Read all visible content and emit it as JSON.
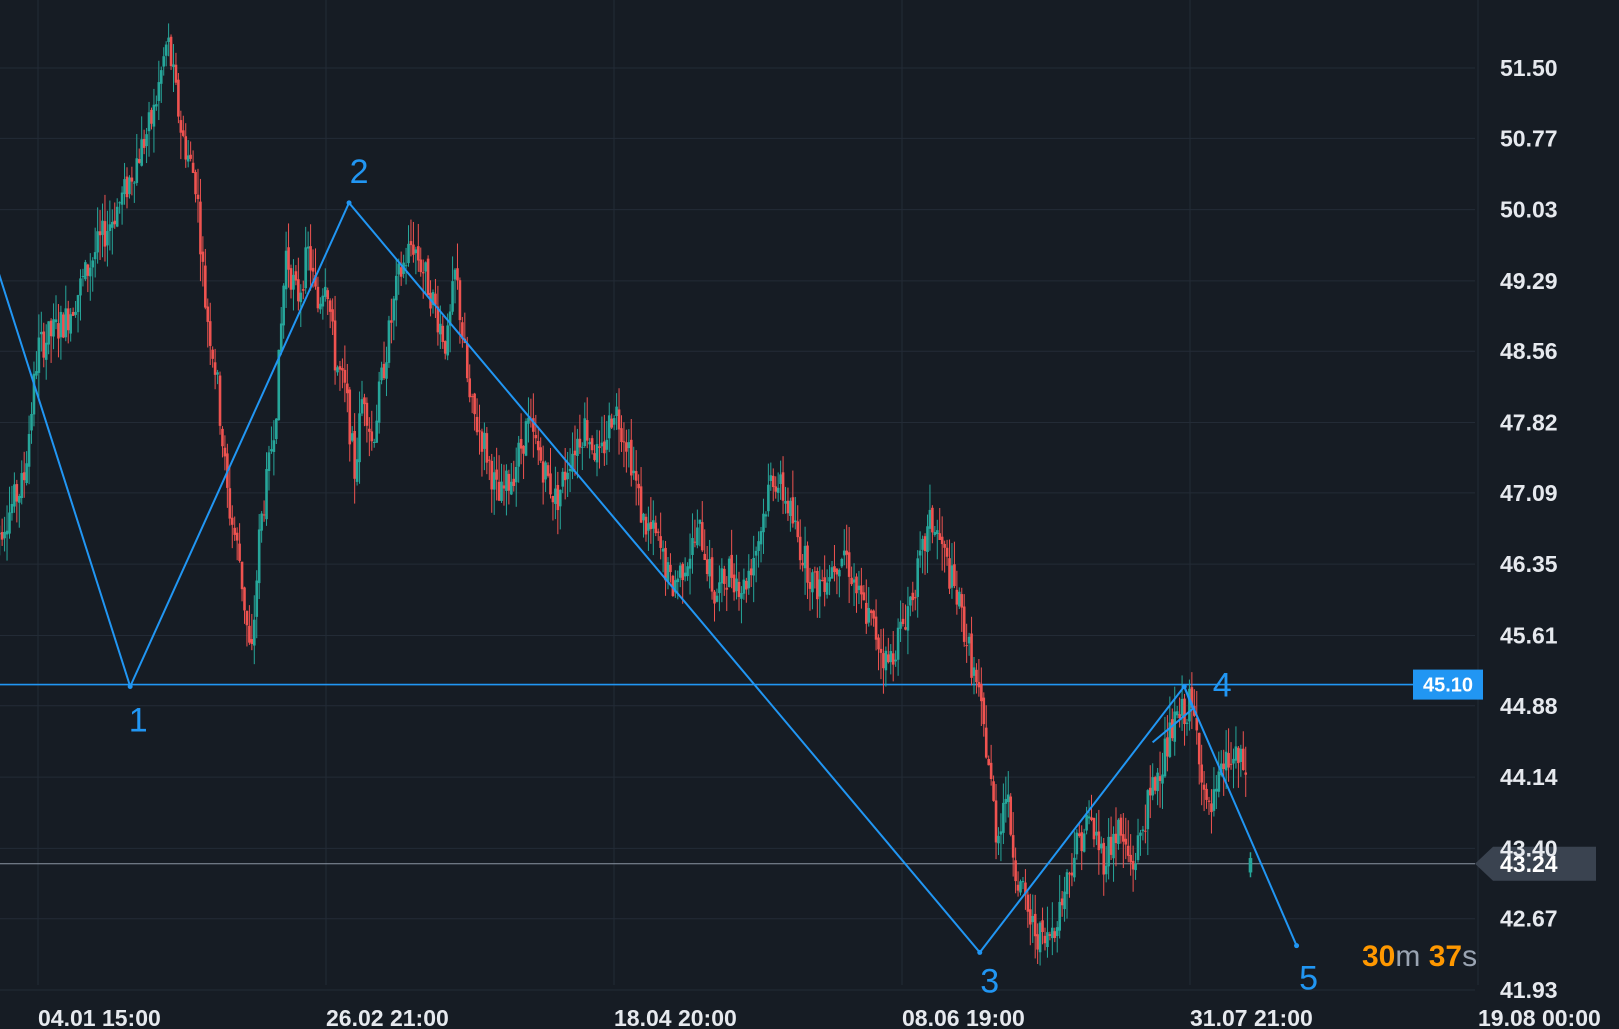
{
  "colors": {
    "background": "#161c24",
    "grid": "#232b36",
    "up": "#26a69a",
    "down": "#ef5350",
    "wave": "#2196f3",
    "level_badge": "#2196f3",
    "current_line": "#8a94a2",
    "current_badge": "#3a4350",
    "countdown_number": "#ff9800",
    "countdown_unit": "#9aa4b2",
    "tick_text": "#e6e9ee"
  },
  "countdown": {
    "minutes": "30",
    "minutes_unit": "m",
    "seconds": "37",
    "seconds_unit": "s"
  },
  "chart_data": {
    "type": "candlestick",
    "y_ticks": [
      "51.50",
      "50.77",
      "50.03",
      "49.29",
      "48.56",
      "47.82",
      "47.09",
      "46.35",
      "45.61",
      "44.88",
      "44.14",
      "43.40",
      "42.67",
      "41.93"
    ],
    "x_ticks": [
      "04.01 15:00",
      "26.02 21:00",
      "18.04 20:00",
      "08.06 19:00",
      "31.07 21:00",
      "19.08 00:00"
    ],
    "ylim": [
      41.93,
      51.9
    ],
    "grid": true,
    "horizontal_level": {
      "value": 45.1,
      "label": "45.10"
    },
    "current_price": {
      "value": 43.24,
      "label": "43.24"
    },
    "wave_labels": [
      "1",
      "2",
      "3",
      "4",
      "5"
    ],
    "wave_points": [
      {
        "t": -0.4,
        "y": 51.85,
        "label": ""
      },
      {
        "t": 0.32,
        "y": 45.08,
        "label": "1"
      },
      {
        "t": 1.08,
        "y": 50.1,
        "label": "2"
      },
      {
        "t": 3.27,
        "y": 42.32,
        "label": "3"
      },
      {
        "t": 3.98,
        "y": 45.08,
        "label": "4"
      },
      {
        "t": 4.37,
        "y": 42.39,
        "label": "5"
      }
    ],
    "wave_subtriangle": [
      {
        "t": 3.98,
        "y": 45.08
      },
      {
        "t": 4.01,
        "y": 44.85
      },
      {
        "t": 3.87,
        "y": 44.5
      }
    ],
    "price_anchors": [
      [
        -0.15,
        46.6
      ],
      [
        -0.05,
        47.2
      ],
      [
        0.0,
        48.6
      ],
      [
        0.1,
        48.9
      ],
      [
        0.2,
        49.6
      ],
      [
        0.3,
        50.2
      ],
      [
        0.4,
        51.0
      ],
      [
        0.45,
        51.8
      ],
      [
        0.5,
        50.8
      ],
      [
        0.55,
        50.3
      ],
      [
        0.58,
        49.1
      ],
      [
        0.62,
        48.3
      ],
      [
        0.66,
        47.0
      ],
      [
        0.7,
        46.4
      ],
      [
        0.74,
        45.3
      ],
      [
        0.77,
        46.7
      ],
      [
        0.8,
        47.3
      ],
      [
        0.83,
        48.1
      ],
      [
        0.86,
        49.6
      ],
      [
        0.9,
        49.1
      ],
      [
        0.94,
        49.6
      ],
      [
        0.97,
        49.0
      ],
      [
        1.0,
        49.4
      ],
      [
        1.03,
        48.5
      ],
      [
        1.07,
        48.1
      ],
      [
        1.1,
        47.3
      ],
      [
        1.13,
        48.2
      ],
      [
        1.16,
        47.6
      ],
      [
        1.2,
        48.4
      ],
      [
        1.25,
        49.3
      ],
      [
        1.3,
        49.7
      ],
      [
        1.35,
        49.3
      ],
      [
        1.38,
        49.0
      ],
      [
        1.42,
        48.6
      ],
      [
        1.45,
        49.4
      ],
      [
        1.5,
        48.0
      ],
      [
        1.55,
        47.6
      ],
      [
        1.6,
        47.0
      ],
      [
        1.65,
        47.3
      ],
      [
        1.7,
        47.8
      ],
      [
        1.75,
        47.4
      ],
      [
        1.8,
        47.0
      ],
      [
        1.85,
        47.5
      ],
      [
        1.9,
        47.8
      ],
      [
        1.95,
        47.4
      ],
      [
        2.0,
        48.0
      ],
      [
        2.05,
        47.6
      ],
      [
        2.1,
        46.8
      ],
      [
        2.15,
        46.6
      ],
      [
        2.2,
        46.1
      ],
      [
        2.25,
        46.4
      ],
      [
        2.3,
        46.7
      ],
      [
        2.35,
        46.0
      ],
      [
        2.4,
        46.3
      ],
      [
        2.45,
        46.1
      ],
      [
        2.5,
        46.6
      ],
      [
        2.55,
        47.3
      ],
      [
        2.6,
        47.0
      ],
      [
        2.65,
        46.5
      ],
      [
        2.7,
        46.1
      ],
      [
        2.75,
        46.3
      ],
      [
        2.8,
        46.5
      ],
      [
        2.85,
        46.0
      ],
      [
        2.9,
        45.7
      ],
      [
        2.95,
        45.3
      ],
      [
        3.0,
        45.7
      ],
      [
        3.05,
        46.2
      ],
      [
        3.1,
        46.8
      ],
      [
        3.13,
        46.6
      ],
      [
        3.17,
        46.2
      ],
      [
        3.2,
        45.9
      ],
      [
        3.23,
        45.5
      ],
      [
        3.27,
        44.9
      ],
      [
        3.3,
        44.3
      ],
      [
        3.33,
        43.5
      ],
      [
        3.36,
        44.0
      ],
      [
        3.4,
        43.1
      ],
      [
        3.45,
        42.6
      ],
      [
        3.5,
        42.4
      ],
      [
        3.55,
        42.8
      ],
      [
        3.6,
        43.4
      ],
      [
        3.65,
        43.7
      ],
      [
        3.7,
        43.3
      ],
      [
        3.75,
        43.6
      ],
      [
        3.8,
        43.2
      ],
      [
        3.85,
        43.8
      ],
      [
        3.9,
        44.3
      ],
      [
        3.95,
        44.7
      ],
      [
        4.0,
        44.9
      ],
      [
        4.03,
        44.5
      ],
      [
        4.06,
        43.7
      ],
      [
        4.09,
        43.9
      ],
      [
        4.12,
        44.3
      ],
      [
        4.16,
        44.3
      ],
      [
        4.2,
        44.2
      ]
    ],
    "last_candle": {
      "t": 4.21,
      "open": 43.15,
      "close": 43.3,
      "high": 43.36,
      "low": 43.1
    }
  }
}
